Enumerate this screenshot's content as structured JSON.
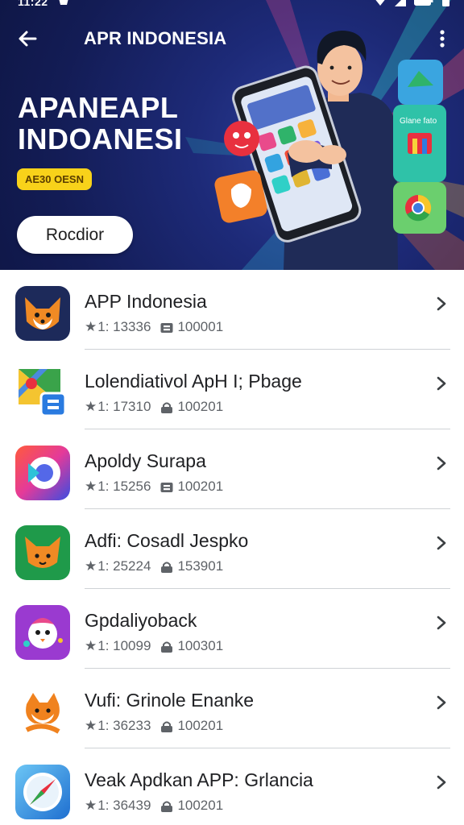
{
  "status_bar": {
    "time": "11:22"
  },
  "header": {
    "title": "APR INDONESIA"
  },
  "banner": {
    "heading_line1": "APANEAPL",
    "heading_line2": "INDOANESI",
    "badge": "AE30 OESN",
    "button_label": "Rocdior",
    "card_text": "Glane fato"
  },
  "apps": [
    {
      "name": "APP Indonesia",
      "rating": "1: 13336",
      "downloads": "100001",
      "icon": "fox-icon",
      "dl_style": "box"
    },
    {
      "name": "Lolendiativol ApH I; Pbage",
      "rating": "1: 17310",
      "downloads": "100201",
      "icon": "maps-icon",
      "dl_style": "lock"
    },
    {
      "name": "Apoldy Surapa",
      "rating": "1: 15256",
      "downloads": "100201",
      "icon": "swirl-icon",
      "dl_style": "box"
    },
    {
      "name": "Adfi: Cosadl Jespko",
      "rating": "1: 25224",
      "downloads": "153901",
      "icon": "cat-icon",
      "dl_style": "lock"
    },
    {
      "name": "Gpdaliyoback",
      "rating": "1: 10099",
      "downloads": "100301",
      "icon": "bird-icon",
      "dl_style": "lock"
    },
    {
      "name": "Vufi: Grinole Enanke",
      "rating": "1: 36233",
      "downloads": "100201",
      "icon": "shiba-icon",
      "dl_style": "lock"
    },
    {
      "name": "Veak Apdkan APP: Grlancia",
      "rating": "1: 36439",
      "downloads": "100201",
      "icon": "compass-icon",
      "dl_style": "lock"
    }
  ],
  "colors": {
    "hero_bg": "#1d2a78",
    "badge": "#f8d21a",
    "divider": "#cfd2d6"
  }
}
